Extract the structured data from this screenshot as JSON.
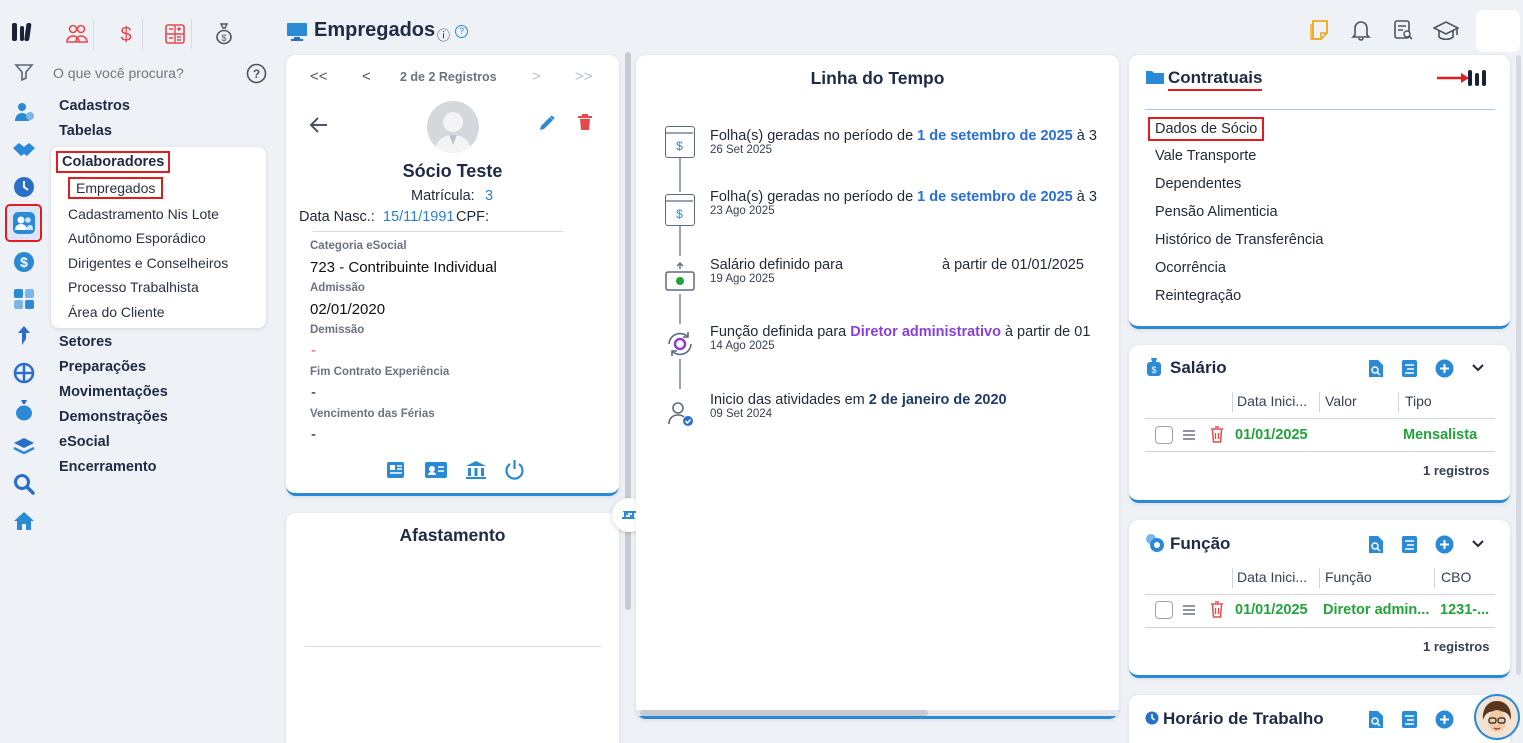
{
  "search": {
    "placeholder": "O que você procura?"
  },
  "nav": {
    "headings": [
      "Cadastros",
      "Tabelas",
      "Colaboradores",
      "Setores",
      "Preparações",
      "Movimentações",
      "Demonstrações",
      "eSocial",
      "Encerramento"
    ],
    "sub_items": [
      "Empregados",
      "Cadastramento Nis Lote",
      "Autônomo Esporádico",
      "Dirigentes e Conselheiros",
      "Processo Trabalhista",
      "Área do Cliente"
    ]
  },
  "page": {
    "title": "Empregados",
    "info_icon": "ⓘ",
    "help_icon": "?"
  },
  "pager": {
    "first": "<<",
    "prev": "<",
    "label": "2 de 2 Registros",
    "next": ">",
    "last": ">>"
  },
  "person": {
    "name": "Sócio Teste",
    "matricula_label": "Matrícula:",
    "matricula": "3",
    "dob_label": "Data Nasc.:",
    "dob": "15/11/1991",
    "cpf_label": "CPF:",
    "categoria_label": "Categoria eSocial",
    "categoria": "723 - Contribuinte Individual",
    "admissao_label": "Admissão",
    "admissao": "02/01/2020",
    "demissao_label": "Demissão",
    "demissao": "-",
    "fim_contrato_label": "Fim Contrato Experiência",
    "fim_contrato": "-",
    "vencimento_label": "Vencimento das Férias",
    "vencimento": "-"
  },
  "afastamento": {
    "title": "Afastamento"
  },
  "timeline": {
    "title": "Linha do Tempo",
    "items": [
      {
        "pre": "Folha(s) geradas no período de ",
        "hl": "1 de setembro de 2025",
        "post": " à 3",
        "date": "26 Set 2025"
      },
      {
        "pre": "Folha(s) geradas no período de ",
        "hl": "1 de setembro de 2025",
        "post": " à 3",
        "date": "23 Ago 2025"
      },
      {
        "pre": "Salário definido para",
        "hl": "",
        "post": "à partir de 01/01/2025",
        "date": "19 Ago 2025"
      },
      {
        "pre": "Função definida para ",
        "hl": "Diretor administrativo",
        "post": " à partir de 01",
        "date": "14 Ago 2025"
      },
      {
        "pre": "Inicio das atividades em ",
        "hl": "2 de janeiro de 2020",
        "post": "",
        "date": "09 Set 2024"
      }
    ]
  },
  "contratuais": {
    "title": "Contratuais",
    "links": [
      "Dados de Sócio",
      "Vale Transporte",
      "Dependentes",
      "Pensão Alimenticia",
      "Histórico de Transferência",
      "Ocorrência",
      "Reintegração"
    ]
  },
  "salario": {
    "title": "Salário",
    "headers": [
      "Data Inici...",
      "Valor",
      "Tipo"
    ],
    "row": {
      "date": "01/01/2025",
      "valor": "",
      "tipo": "Mensalista"
    },
    "count": "1 registros"
  },
  "funcao": {
    "title": "Função",
    "headers": [
      "Data Inici...",
      "Função",
      "CBO"
    ],
    "row": {
      "date": "01/01/2025",
      "funcao": "Diretor admin...",
      "cbo": "1231-..."
    },
    "count": "1 registros"
  },
  "horario": {
    "title": "Horário de Trabalho"
  },
  "colors": {
    "accent": "#2a8ad6",
    "danger": "#e11d1d",
    "success": "#22a33a",
    "highlight": "#2a6fd6",
    "purple": "#8b3fd9"
  }
}
